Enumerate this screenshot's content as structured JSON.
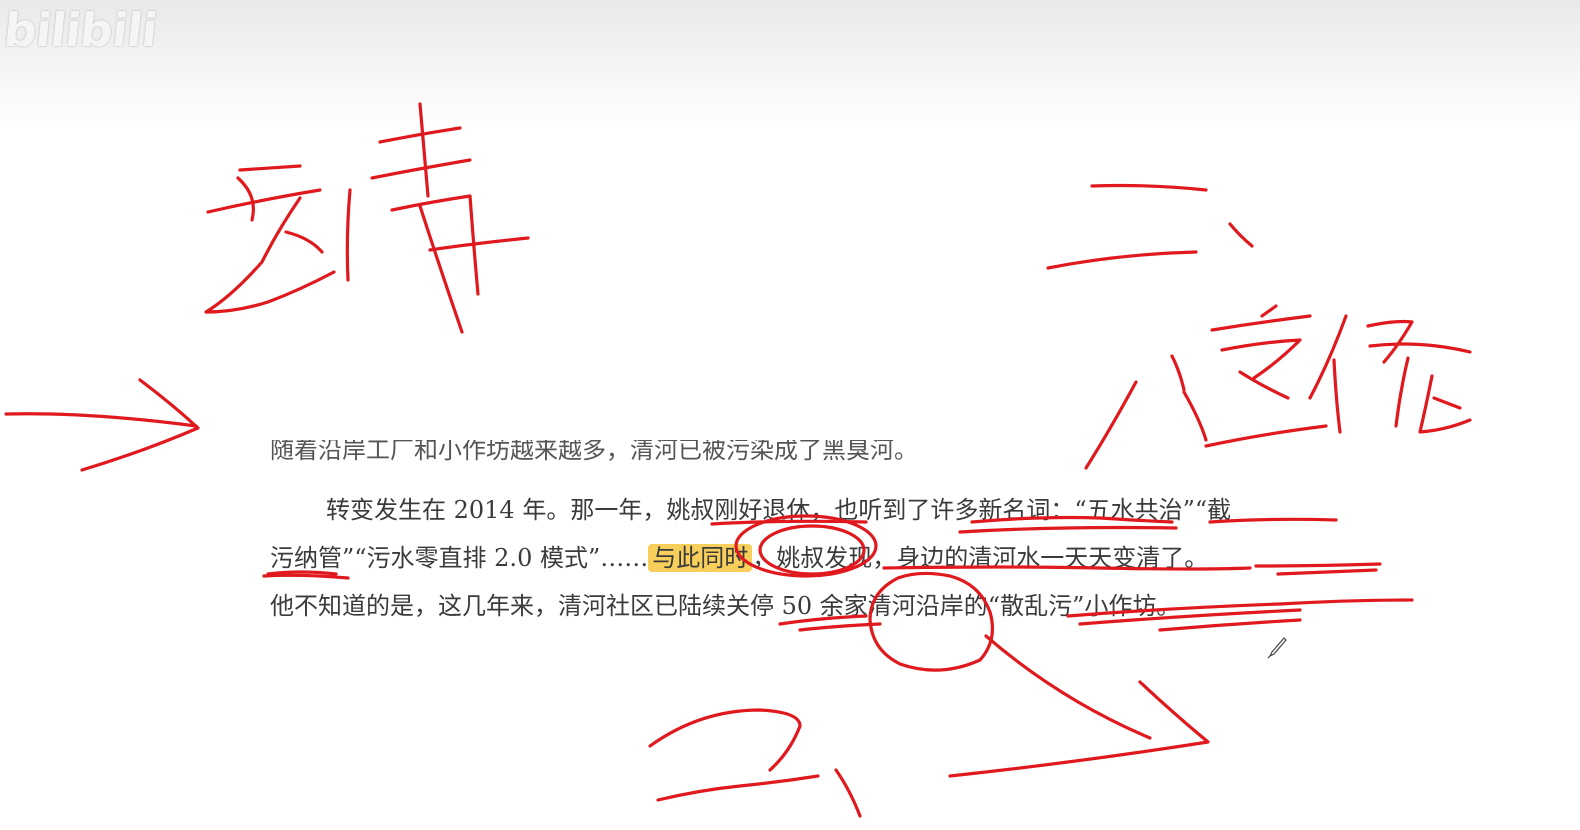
{
  "watermark": {
    "text": "bilibili"
  },
  "document": {
    "cut_line": "随着沿岸工厂和小作坊越来越多，清河已被污染成了黑臭河。",
    "p1": {
      "a": "转变发生在 2014 年。那一年，姚叔刚好退休，也听到了许多新名词：",
      "b": "“五水共治”“截"
    },
    "p2": {
      "a": "污纳管”“污水零直排 2.0 模式”……",
      "highlight": "与此同时",
      "b": "，姚叔发现，身边的清河水一天天变清了。"
    },
    "p3": {
      "text": "他不知道的是，这几年来，清河社区已陆续关停 50 余家清河沿岸的“散乱污”小作坊。"
    }
  },
  "ink_colors": {
    "pen": "#e0191e",
    "highlight": "#f7cf5a"
  },
  "cursor": {
    "icon": "pen-cursor-icon"
  }
}
